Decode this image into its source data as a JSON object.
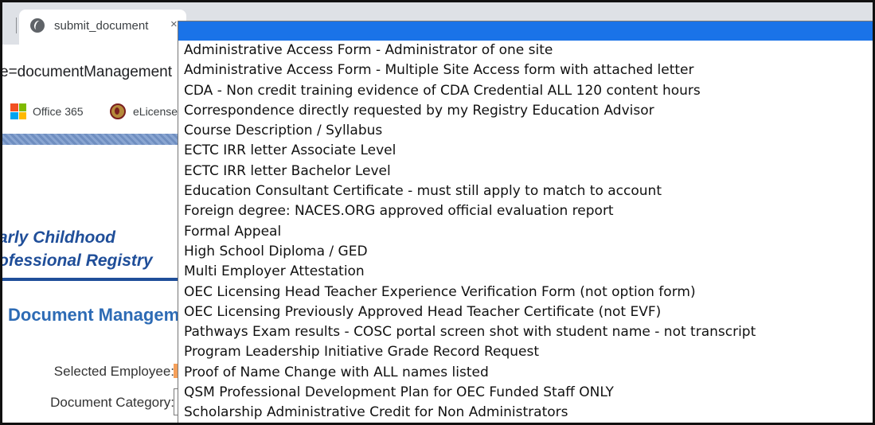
{
  "browser": {
    "tab_title": "submit_document",
    "tab_close": "×",
    "url_text": "e=documentManagement",
    "bookmarks": [
      {
        "label": "Office 365",
        "icon": "office-365-icon"
      },
      {
        "label": "eLicense",
        "icon": "elicense-icon"
      }
    ]
  },
  "page": {
    "brand_line1": "arly Childhood",
    "brand_line2": "ofessional Registry",
    "title": "Document Management",
    "selected_employee_label": "Selected Employee:",
    "document_category_label": "Document Category:"
  },
  "dropdown": {
    "selected_index": 0,
    "options": [
      "",
      "Administrative Access Form - Administrator of one site",
      "Administrative Access Form - Multiple Site Access form with attached letter",
      "CDA - Non credit training evidence of CDA Credential ALL 120 content hours",
      "Correspondence directly requested by my Registry Education Advisor",
      "Course Description / Syllabus",
      "ECTC IRR letter Associate Level",
      "ECTC IRR letter Bachelor Level",
      "Education Consultant Certificate - must still apply to match to account",
      "Foreign degree: NACES.ORG approved official evaluation report",
      "Formal Appeal",
      "High School Diploma / GED",
      "Multi Employer Attestation",
      "OEC Licensing Head Teacher Experience Verification Form (not option form)",
      "OEC Licensing Previously Approved Head Teacher Certificate (not EVF)",
      "Pathways Exam results - COSC portal screen shot with student name - not transcript",
      "Program Leadership Initiative Grade Record Request",
      "Proof of Name Change with ALL names listed",
      "QSM Professional Development Plan for OEC Funded Staff ONLY",
      "Scholarship Administrative Credit for Non Administrators"
    ]
  },
  "colors": {
    "selection_highlight": "#1a73e8",
    "brand_blue": "#1f4e99",
    "title_blue": "#2d6bb5"
  }
}
